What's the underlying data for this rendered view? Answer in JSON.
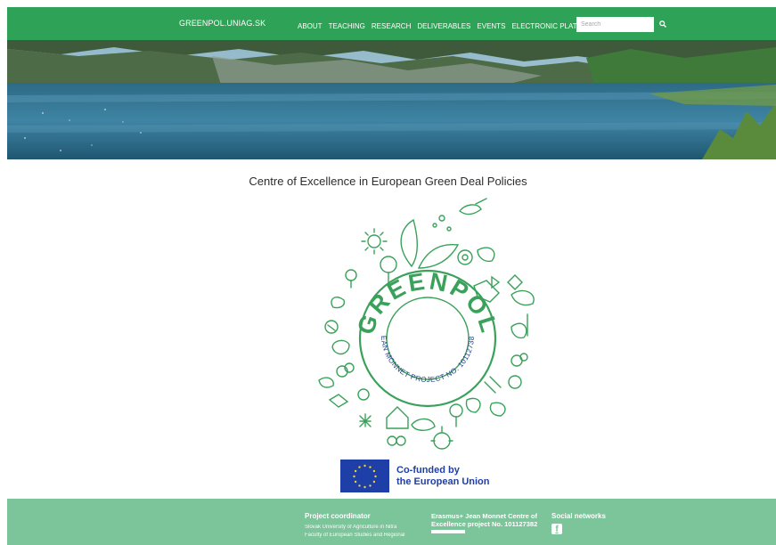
{
  "nav": {
    "site_title": "GREENPOL.UNIAG.SK",
    "links": [
      "ABOUT",
      "TEACHING",
      "RESEARCH",
      "DELIVERABLES",
      "EVENTS",
      "ELECTRONIC PLATFORM"
    ],
    "search_placeholder": "Search"
  },
  "hero": {
    "alt": "mountain lake banner"
  },
  "main": {
    "headline": "Centre of Excellence in European Green Deal Policies",
    "logo": {
      "word": "GREENPOL",
      "ring_text": "JEAN MONNET PROJECT NO. 101127382"
    },
    "eu_badge": {
      "line1": "Co-funded by",
      "line2": "the European Union"
    }
  },
  "footer": {
    "col1": {
      "heading": "Project coordinator",
      "lines": [
        "Slovak University of Agriculture in Nitra",
        "Faculty of European Studies and Regional"
      ]
    },
    "col2": {
      "heading": "Erasmus+ Jean Monnet Centre of Excellence project No. 101127382"
    },
    "col3": {
      "heading": "Social networks"
    }
  },
  "colors": {
    "brand_green": "#2ea256",
    "footer_green": "#7cc49a",
    "eu_blue": "#1f3fa8"
  },
  "icons": [
    "search-icon",
    "facebook-icon"
  ]
}
